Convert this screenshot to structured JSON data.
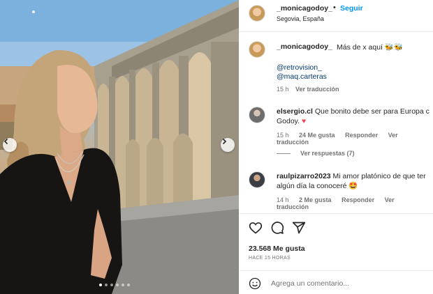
{
  "post": {
    "username": "_monicagodoy_",
    "follow_separator": "•",
    "follow_label": "Seguir",
    "location": "Segovia, España",
    "caption_text": "Más de x aquí 🐝🐝",
    "mentions": [
      "@retrovision_",
      "@maq.carteras"
    ],
    "caption_time": "15 h",
    "translate_label": "Ver traducción"
  },
  "comments": [
    {
      "username": "elsergio.cl",
      "text_line1": "Que bonito debe ser para Europa c",
      "text_line2": "Godoy.",
      "heart": "♥",
      "time": "15 h",
      "likes": "24 Me gusta",
      "reply_label": "Responder",
      "translate_label": "Ver traducción",
      "view_replies_label": "Ver respuestas (7)"
    },
    {
      "username": "raulpizarro2023",
      "text_line1": "Mi amor platónico de que ter",
      "text_line2": "algún día la conoceré 🤩",
      "time": "14 h",
      "likes": "2 Me gusta",
      "reply_label": "Responder",
      "translate_label": "Ver traducción"
    }
  ],
  "actions": {
    "likes_count": "23.568 Me gusta",
    "time_ago": "HACE 15 HORAS",
    "icons": [
      "heart-icon",
      "comment-icon",
      "share-icon"
    ]
  },
  "comment_box": {
    "placeholder": "Agrega un comentario..."
  },
  "carousel": {
    "slides": 6,
    "active_slide": 1
  },
  "colors": {
    "accent": "#0095f6",
    "mention": "#00376b",
    "heart": "#ed4956",
    "muted": "#737373"
  }
}
